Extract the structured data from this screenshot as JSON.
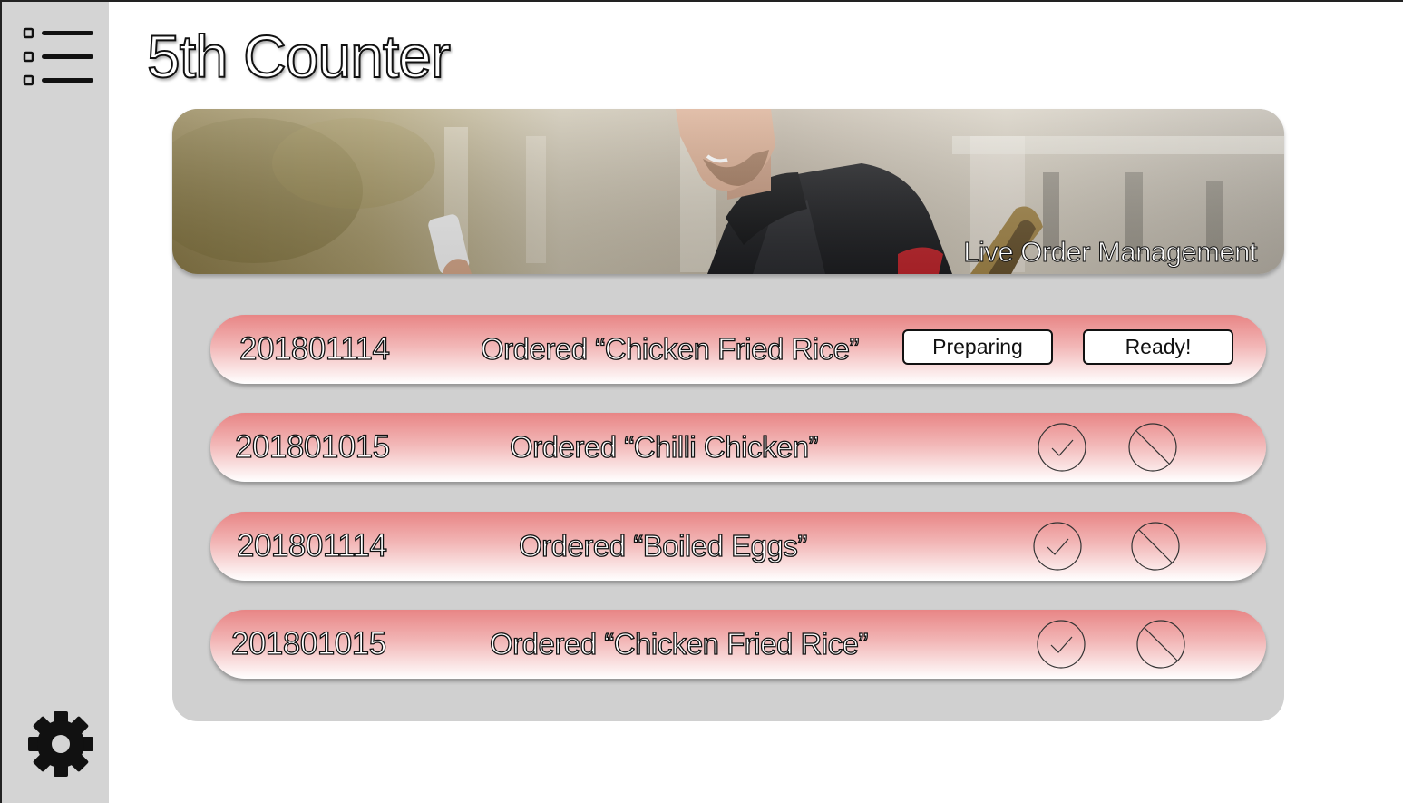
{
  "app": {
    "title": "5th Counter"
  },
  "sidebar": {
    "menu_icon": "list-menu-icon",
    "settings_icon": "gear-icon"
  },
  "banner": {
    "title": "Live Order Management",
    "image": "delivery-person-with-phone-photo"
  },
  "orders": [
    {
      "id": "201801114",
      "description": "Ordered “Chicken Fried Rice”",
      "actions": {
        "preparing_label": "Preparing",
        "ready_label": "Ready!"
      }
    },
    {
      "id": "201801015",
      "description": "Ordered “Chilli Chicken”",
      "actions": {
        "accept_icon": "check-icon",
        "reject_icon": "block-icon"
      }
    },
    {
      "id": "201801114",
      "description": "Ordered “Boiled Eggs”",
      "actions": {
        "accept_icon": "check-icon",
        "reject_icon": "block-icon"
      }
    },
    {
      "id": "201801015",
      "description": "Ordered “Chicken Fried Rice”",
      "actions": {
        "accept_icon": "check-icon",
        "reject_icon": "block-icon"
      }
    }
  ],
  "colors": {
    "sidebar": "#d4d4d4",
    "panel": "#d0d0d0",
    "row_top": "#e88585",
    "row_bottom": "#ffffff"
  }
}
